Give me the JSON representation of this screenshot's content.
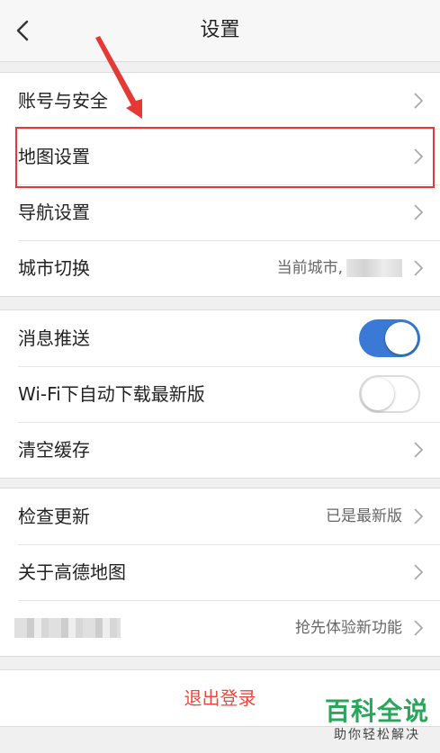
{
  "header": {
    "title": "设置"
  },
  "account_group": {
    "items": [
      {
        "label": "账号与安全"
      },
      {
        "label": "地图设置"
      },
      {
        "label": "导航设置"
      },
      {
        "label": "城市切换",
        "value": "当前城市,"
      }
    ]
  },
  "settings_group": {
    "items": [
      {
        "label": "消息推送",
        "toggle": true
      },
      {
        "label": "Wi-Fi下自动下载最新版",
        "toggle": false
      },
      {
        "label": "清空缓存"
      }
    ]
  },
  "about_group": {
    "items": [
      {
        "label": "检查更新",
        "value": "已是最新版"
      },
      {
        "label": "关于高德地图"
      },
      {
        "value": "抢先体验新功能"
      }
    ]
  },
  "logout": {
    "label": "退出登录"
  },
  "watermark": {
    "main": "百科全说",
    "sub": "助你轻松解决"
  },
  "colors": {
    "accent": "#3a7ad6",
    "logout": "#e84a3d",
    "highlight": "#e53935",
    "watermark": "#2aa65b"
  },
  "icons": [
    "back-icon",
    "chevron-right-icon",
    "annotation-arrow"
  ]
}
